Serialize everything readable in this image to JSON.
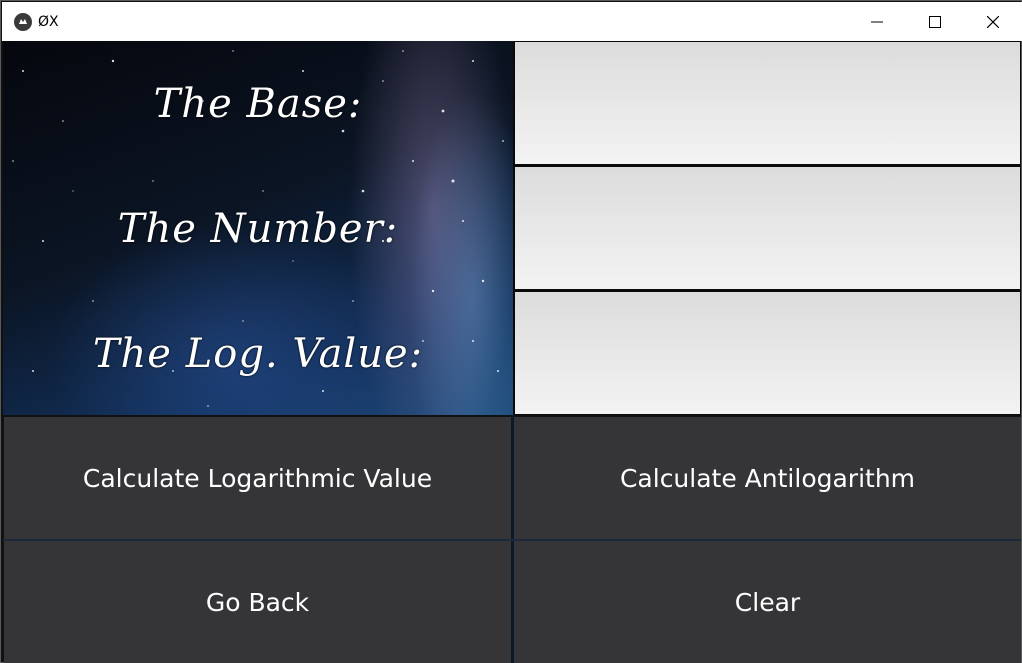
{
  "window": {
    "title": "ØX",
    "controls": {
      "minimize_icon": "minimize-icon",
      "maximize_icon": "maximize-icon",
      "close_icon": "close-icon"
    }
  },
  "labels": {
    "base": "The Base:",
    "number": "The Number:",
    "log_value": "The Log. Value:"
  },
  "fields": {
    "base": {
      "value": "",
      "placeholder": ""
    },
    "number": {
      "value": "",
      "placeholder": ""
    },
    "log_value": {
      "value": "",
      "placeholder": ""
    }
  },
  "buttons": {
    "calc_log": "Calculate Logarithmic Value",
    "calc_antilog": "Calculate Antilogarithm",
    "go_back": "Go Back",
    "clear": "Clear"
  },
  "colors": {
    "button_bg": "#353538",
    "button_text": "#ffffff",
    "field_top": "#dcdcdc",
    "field_bottom": "#f3f3f3"
  }
}
